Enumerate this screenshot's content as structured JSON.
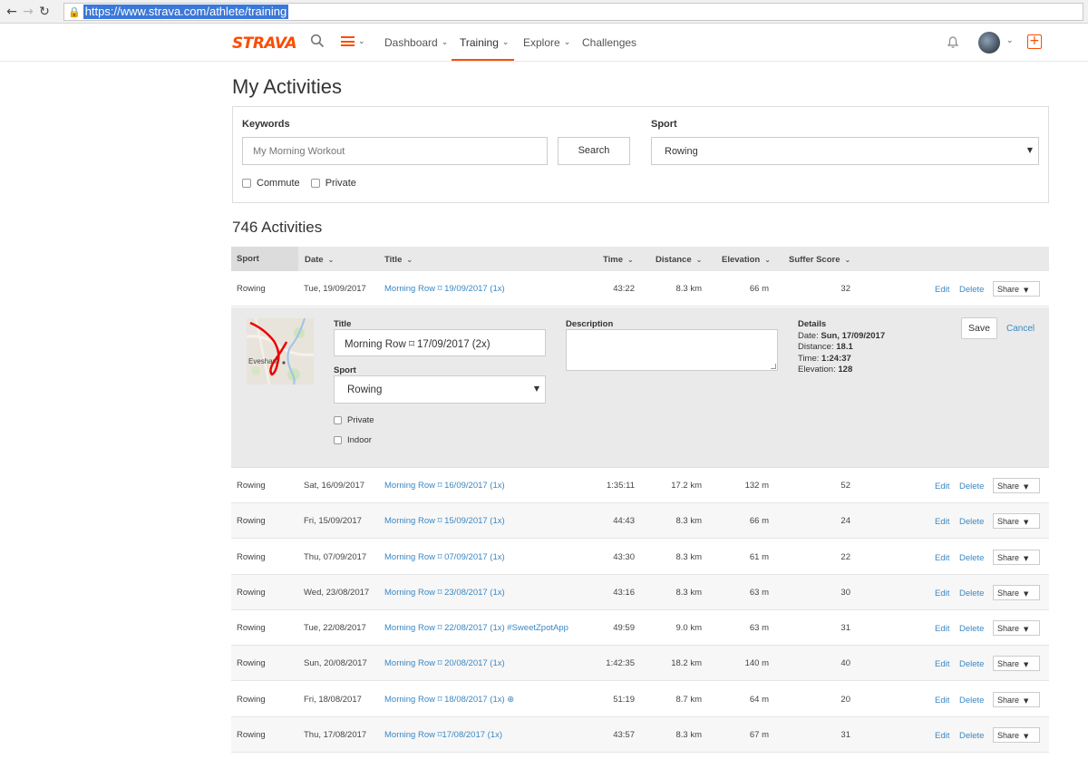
{
  "browser": {
    "url": "https://www.strava.com/athlete/training",
    "back_icon": "←",
    "forward_icon": "→",
    "reload_icon": "↻"
  },
  "header": {
    "logo": "STRAVA",
    "nav": {
      "dashboard": "Dashboard",
      "training": "Training",
      "explore": "Explore",
      "challenges": "Challenges"
    },
    "upload_icon": "+"
  },
  "page": {
    "title": "My Activities",
    "filters": {
      "keywords_label": "Keywords",
      "keywords_placeholder": "My Morning Workout",
      "search_label": "Search",
      "sport_label": "Sport",
      "sport_value": "Rowing",
      "commute_label": "Commute",
      "private_label": "Private"
    },
    "count": "746 Activities"
  },
  "table": {
    "headers": {
      "sport": "Sport",
      "date": "Date",
      "title": "Title",
      "time": "Time",
      "distance": "Distance",
      "elevation": "Elevation",
      "suffer": "Suffer Score"
    },
    "actions": {
      "edit": "Edit",
      "delete": "Delete",
      "share": "Share"
    },
    "rows": [
      {
        "sport": "Rowing",
        "date": "Tue, 19/09/2017",
        "title": "Morning Row ⌑ 19/09/2017 (1x)",
        "time": "43:22",
        "distance": "8.3 km",
        "elevation": "66 m",
        "suffer": "32"
      },
      {
        "sport": "Rowing",
        "date": "Sat, 16/09/2017",
        "title": "Morning Row ⌑ 16/09/2017 (1x)",
        "time": "1:35:11",
        "distance": "17.2 km",
        "elevation": "132 m",
        "suffer": "52"
      },
      {
        "sport": "Rowing",
        "date": "Fri, 15/09/2017",
        "title": "Morning Row ⌑ 15/09/2017 (1x)",
        "time": "44:43",
        "distance": "8.3 km",
        "elevation": "66 m",
        "suffer": "24"
      },
      {
        "sport": "Rowing",
        "date": "Thu, 07/09/2017",
        "title": "Morning Row ⌑ 07/09/2017 (1x)",
        "time": "43:30",
        "distance": "8.3 km",
        "elevation": "61 m",
        "suffer": "22"
      },
      {
        "sport": "Rowing",
        "date": "Wed, 23/08/2017",
        "title": "Morning Row ⌑ 23/08/2017 (1x)",
        "time": "43:16",
        "distance": "8.3 km",
        "elevation": "63 m",
        "suffer": "30"
      },
      {
        "sport": "Rowing",
        "date": "Tue, 22/08/2017",
        "title": "Morning Row ⌑ 22/08/2017 (1x) #SweetZpotApp",
        "time": "49:59",
        "distance": "9.0 km",
        "elevation": "63 m",
        "suffer": "31"
      },
      {
        "sport": "Rowing",
        "date": "Sun, 20/08/2017",
        "title": "Morning Row ⌑ 20/08/2017 (1x)",
        "time": "1:42:35",
        "distance": "18.2 km",
        "elevation": "140 m",
        "suffer": "40"
      },
      {
        "sport": "Rowing",
        "date": "Fri, 18/08/2017",
        "title": "Morning Row ⌑ 18/08/2017 (1x) ⊕",
        "time": "51:19",
        "distance": "8.7 km",
        "elevation": "64 m",
        "suffer": "20"
      },
      {
        "sport": "Rowing",
        "date": "Thu, 17/08/2017",
        "title": "Morning Row ⌑17/08/2017 (1x)",
        "time": "43:57",
        "distance": "8.3 km",
        "elevation": "67 m",
        "suffer": "31"
      }
    ]
  },
  "edit_panel": {
    "map_label": "Evesham",
    "title_label": "Title",
    "title_value": "Morning Row ⌑ 17/09/2017 (2x)",
    "sport_label": "Sport",
    "sport_value": "Rowing",
    "private_label": "Private",
    "indoor_label": "Indoor",
    "description_label": "Description",
    "details_label": "Details",
    "details": {
      "date_key": "Date:",
      "date_val": "Sun, 17/09/2017",
      "distance_key": "Distance:",
      "distance_val": "18.1",
      "time_key": "Time:",
      "time_val": "1:24:37",
      "elevation_key": "Elevation:",
      "elevation_val": "128"
    },
    "save_label": "Save",
    "cancel_label": "Cancel"
  }
}
